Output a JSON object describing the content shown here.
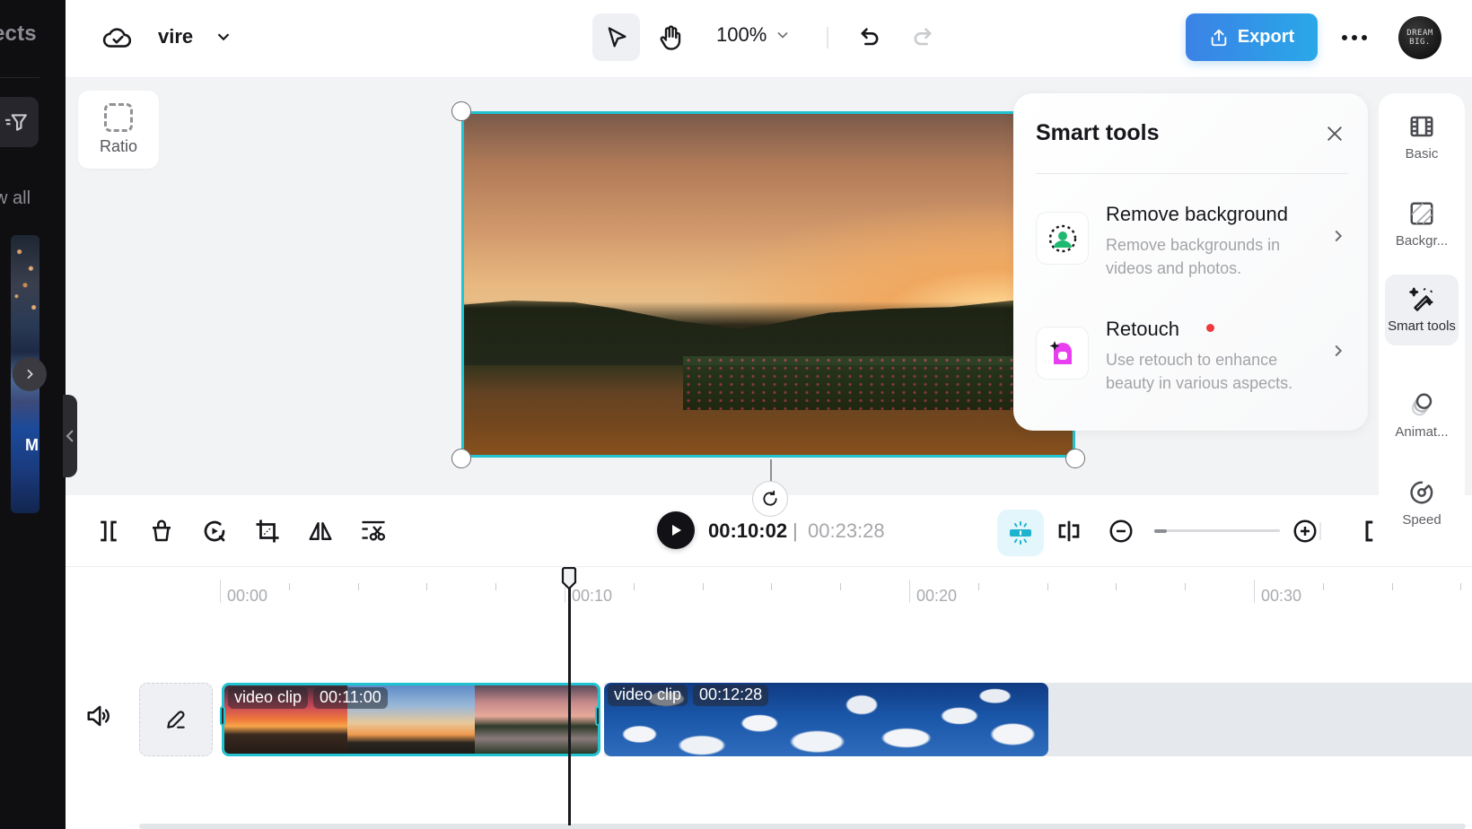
{
  "left_sidebar": {
    "title_fragment": "ects",
    "view_all_fragment": "w all",
    "thumbnail_letter": "M",
    "icons": {
      "filter": "filter-icon",
      "next": "chevron-right-icon",
      "collapse": "chevron-left-icon"
    }
  },
  "topbar": {
    "project_name": "vire",
    "sync_icon": "cloud-check-icon",
    "zoom_level": "100%",
    "export_label": "Export",
    "avatar_text_line1": "DREAM",
    "avatar_text_line2": "BIG."
  },
  "canvas": {
    "ratio_label": "Ratio"
  },
  "smart_tools": {
    "title": "Smart tools",
    "items": [
      {
        "name": "Remove background",
        "description": "Remove backgrounds in videos and photos.",
        "icon": "person-cutout-icon",
        "badge_new": false,
        "accent": "#1fb871"
      },
      {
        "name": "Retouch",
        "description": "Use retouch to enhance beauty in various aspects.",
        "icon": "retouch-icon",
        "badge_new": true,
        "accent": "#e83ef0"
      }
    ]
  },
  "property_bar": {
    "items": [
      {
        "label": "Basic",
        "icon": "film-icon",
        "active": false
      },
      {
        "label": "Backgr...",
        "icon": "background-hatch-icon",
        "active": false
      },
      {
        "label": "Smart tools",
        "icon": "magic-wand-icon",
        "active": true
      },
      {
        "label": "Animat...",
        "icon": "animation-icon",
        "active": false
      },
      {
        "label": "Speed",
        "icon": "speedometer-icon",
        "active": false
      }
    ]
  },
  "timeline": {
    "current_time": "00:10:02",
    "separator": "|",
    "total_time": "00:23:28",
    "zoom_slider_fraction": 0.1,
    "ruler_labels": [
      "00:00",
      "00:10",
      "00:20",
      "00:30"
    ],
    "clips": [
      {
        "label": "video clip",
        "duration": "00:11:00",
        "selected": true
      },
      {
        "label": "video clip",
        "duration": "00:12:28",
        "selected": false
      }
    ],
    "tools": [
      "split-icon",
      "delete-icon",
      "replay-icon",
      "crop-icon",
      "flip-icon",
      "trim-cut-icon"
    ]
  },
  "colors": {
    "accent_teal": "#22c3d0",
    "export_gradient_start": "#3b82e6",
    "export_gradient_end": "#29a8e8",
    "new_badge": "#f0393d"
  }
}
